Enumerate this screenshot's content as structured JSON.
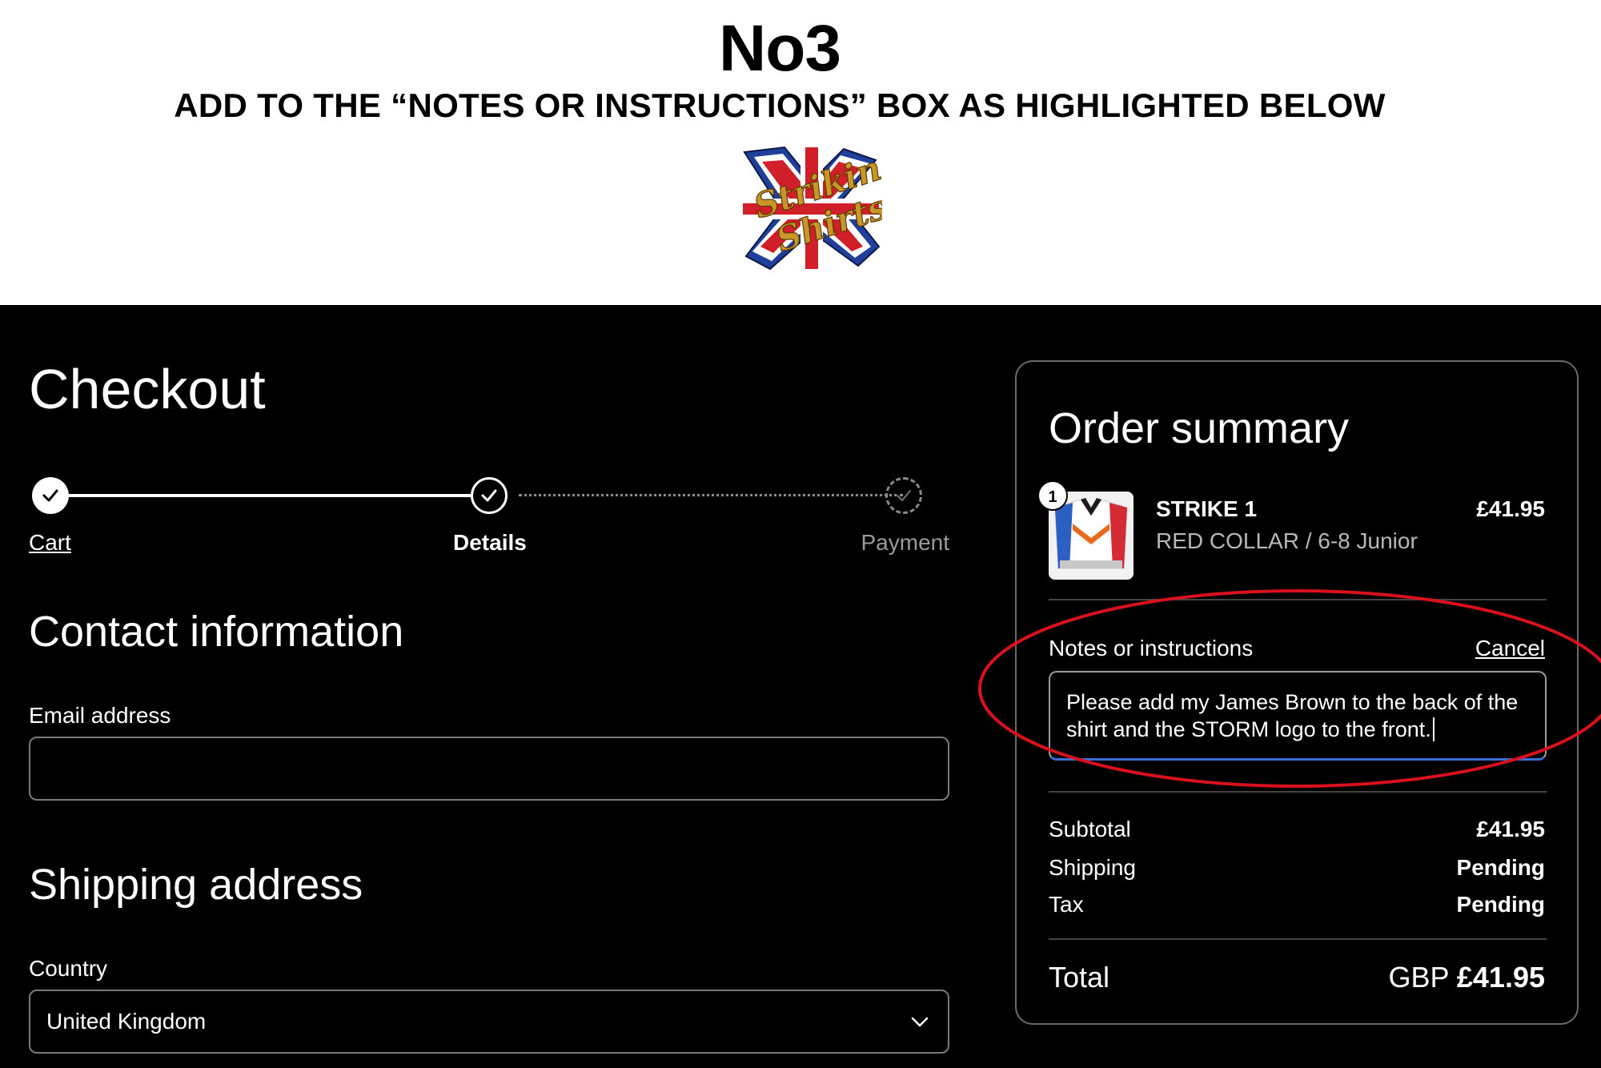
{
  "banner": {
    "title": "No3",
    "subtitle": "ADD TO THE “NOTES OR INSTRUCTIONS” BOX AS HIGHLIGHTED BELOW",
    "logo_text": "Striking Shirts"
  },
  "checkout": {
    "title": "Checkout",
    "steps": [
      {
        "label": "Cart",
        "state": "done"
      },
      {
        "label": "Details",
        "state": "current"
      },
      {
        "label": "Payment",
        "state": "pending"
      }
    ]
  },
  "contact": {
    "title": "Contact information",
    "email_label": "Email address",
    "email_value": ""
  },
  "shipping": {
    "title": "Shipping address",
    "country_label": "Country",
    "country_value": "United Kingdom"
  },
  "summary": {
    "title": "Order summary",
    "item": {
      "quantity": "1",
      "name": "STRIKE 1",
      "variant": "RED COLLAR / 6-8 Junior",
      "price": "£41.95"
    },
    "notes_label": "Notes or instructions",
    "cancel_label": "Cancel",
    "notes_value": "Please add my James Brown to the back of the shirt and the STORM logo to the front.",
    "subtotal_label": "Subtotal",
    "subtotal_value": "£41.95",
    "shipping_label": "Shipping",
    "shipping_value": "Pending",
    "tax_label": "Tax",
    "tax_value": "Pending",
    "total_label": "Total",
    "total_currency": "GBP",
    "total_value": "£41.95"
  },
  "colors": {
    "background": "#000000",
    "highlight": "#d9111d",
    "focus_border": "#3b6fd8"
  }
}
